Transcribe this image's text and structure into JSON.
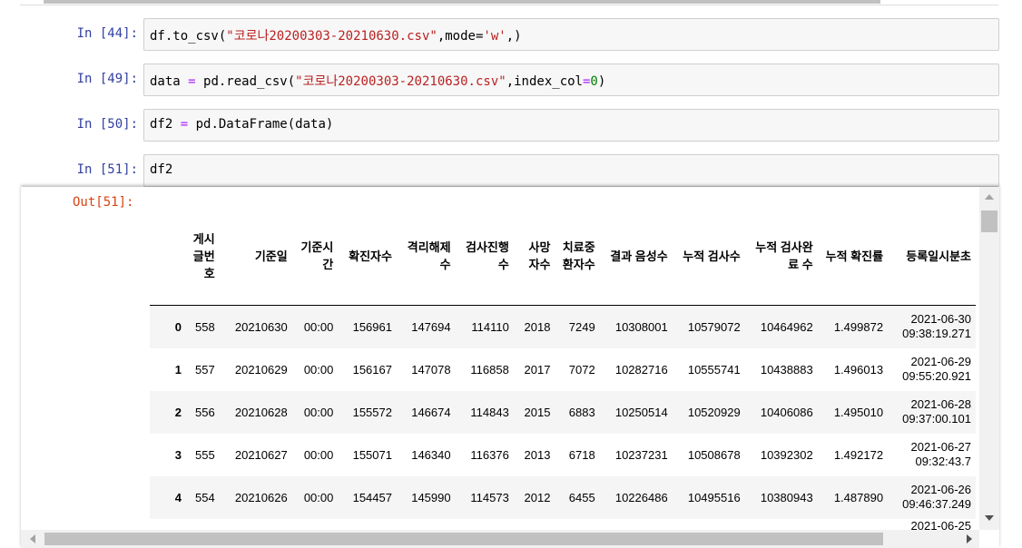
{
  "cells": [
    {
      "prompt": "In [44]:",
      "tokens": [
        {
          "t": "df.to_csv(",
          "c": ""
        },
        {
          "t": "\"코로나20200303-20210630.csv\"",
          "c": "s"
        },
        {
          "t": ",mode=",
          "c": ""
        },
        {
          "t": "'w'",
          "c": "s"
        },
        {
          "t": ",)",
          "c": ""
        }
      ]
    },
    {
      "prompt": "In [49]:",
      "tokens": [
        {
          "t": "data ",
          "c": ""
        },
        {
          "t": "=",
          "c": "o"
        },
        {
          "t": " pd.read_csv(",
          "c": ""
        },
        {
          "t": "\"코로나20200303-20210630.csv\"",
          "c": "s"
        },
        {
          "t": ",index_col",
          "c": ""
        },
        {
          "t": "=",
          "c": "o"
        },
        {
          "t": "0",
          "c": "n"
        },
        {
          "t": ")",
          "c": ""
        }
      ]
    },
    {
      "prompt": "In [50]:",
      "tokens": [
        {
          "t": "df2 ",
          "c": ""
        },
        {
          "t": "=",
          "c": "o"
        },
        {
          "t": " pd.DataFrame(data)",
          "c": ""
        }
      ]
    },
    {
      "prompt": "In [51]:",
      "tokens": [
        {
          "t": "df2",
          "c": ""
        }
      ]
    }
  ],
  "output": {
    "prompt": "Out[51]:",
    "columns": [
      "게시글번호",
      "기준일",
      "기준시간",
      "확진자수",
      "격리해제 수",
      "검사진행수",
      "사망자수",
      "치료중 환자수",
      "결과 음성수",
      "누적 검사수",
      "누적 검사완료 수",
      "누적 확진률",
      "등록일시분초"
    ],
    "rows": [
      {
        "index": "0",
        "cells": [
          "558",
          "20210630",
          "00:00",
          "156961",
          "147694",
          "114110",
          "2018",
          "7249",
          "10308001",
          "10579072",
          "10464962",
          "1.499872"
        ],
        "date": "2021-06-30",
        "time": "09:38:19.271"
      },
      {
        "index": "1",
        "cells": [
          "557",
          "20210629",
          "00:00",
          "156167",
          "147078",
          "116858",
          "2017",
          "7072",
          "10282716",
          "10555741",
          "10438883",
          "1.496013"
        ],
        "date": "2021-06-29",
        "time": "09:55:20.921"
      },
      {
        "index": "2",
        "cells": [
          "556",
          "20210628",
          "00:00",
          "155572",
          "146674",
          "114843",
          "2015",
          "6883",
          "10250514",
          "10520929",
          "10406086",
          "1.495010"
        ],
        "date": "2021-06-28",
        "time": "09:37:00.101"
      },
      {
        "index": "3",
        "cells": [
          "555",
          "20210627",
          "00:00",
          "155071",
          "146340",
          "116376",
          "2013",
          "6718",
          "10237231",
          "10508678",
          "10392302",
          "1.492172"
        ],
        "date": "2021-06-27",
        "time": "09:32:43.7"
      },
      {
        "index": "4",
        "cells": [
          "554",
          "20210626",
          "00:00",
          "154457",
          "145990",
          "114573",
          "2012",
          "6455",
          "10226486",
          "10495516",
          "10380943",
          "1.487890"
        ],
        "date": "2021-06-26",
        "time": "09:46:37.249"
      }
    ],
    "partial_row_date": "2021-06-25"
  },
  "colors": {
    "prompt_in": "#303f9f",
    "prompt_out": "#d84315",
    "string": "#ba2121",
    "operator": "#aa22ff",
    "number": "#008000"
  }
}
